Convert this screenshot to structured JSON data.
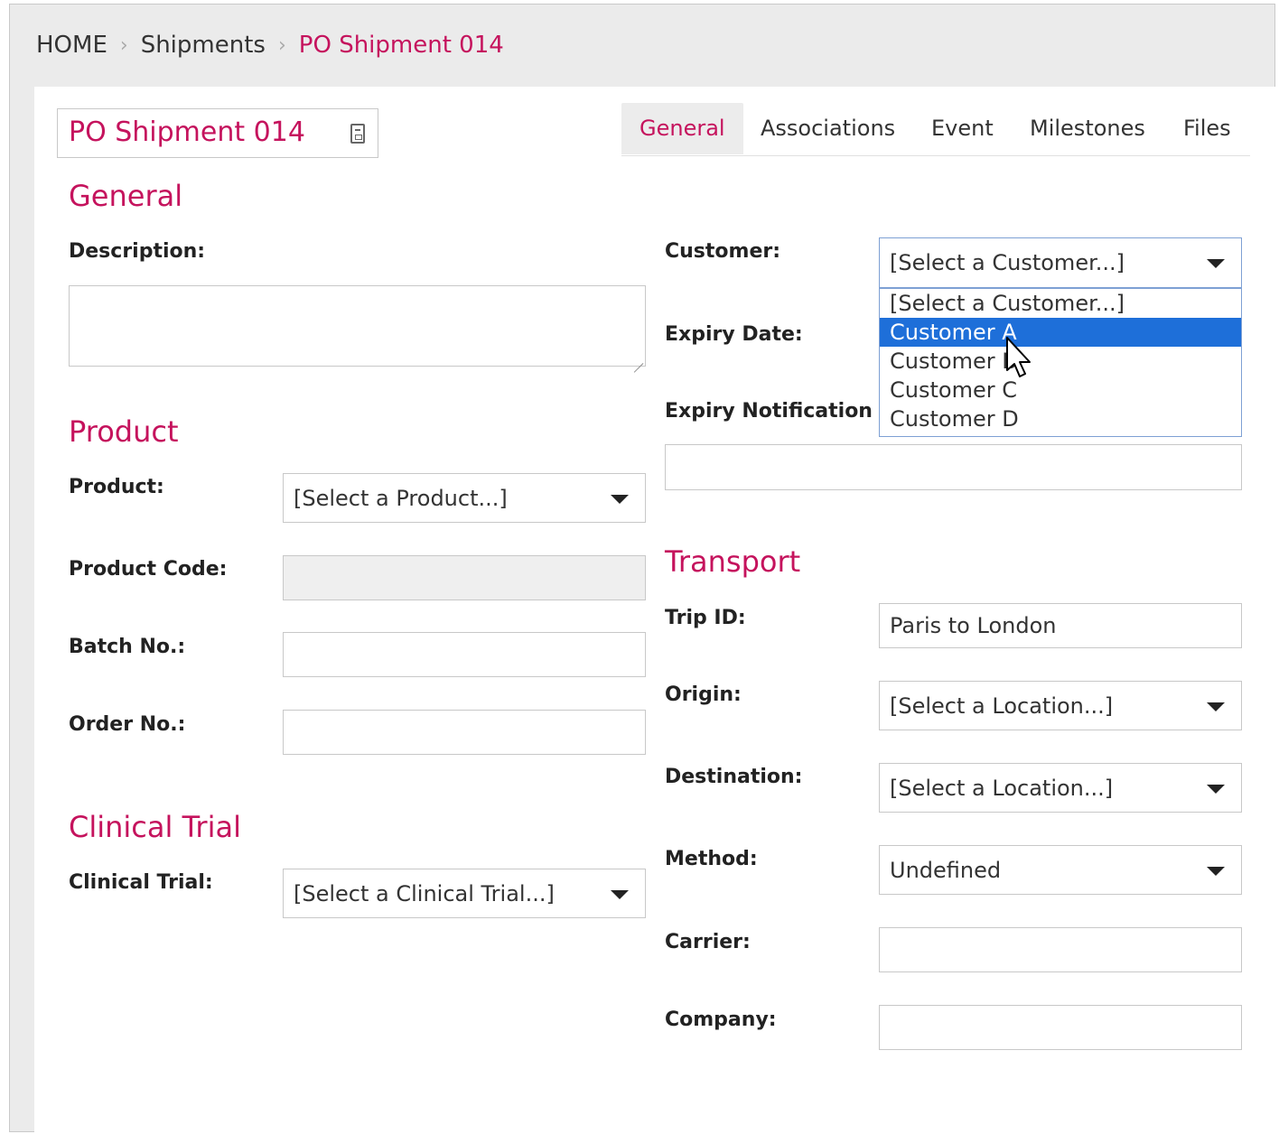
{
  "breadcrumb": {
    "home": "HOME",
    "section": "Shipments",
    "current": "PO Shipment 014"
  },
  "record_title": "PO Shipment 014",
  "tabs": [
    {
      "label": "General",
      "active": true
    },
    {
      "label": "Associations"
    },
    {
      "label": "Event"
    },
    {
      "label": "Milestones"
    },
    {
      "label": "Files"
    }
  ],
  "general": {
    "heading": "General",
    "description_label": "Description:",
    "description_value": "",
    "customer_label": "Customer:",
    "customer_value": "[Select a Customer...]",
    "customer_options": [
      "[Select a Customer...]",
      "Customer A",
      "Customer B",
      "Customer C",
      "Customer D"
    ],
    "customer_highlighted": "Customer A",
    "expiry_date_label": "Expiry Date:",
    "expiry_notification_label": "Expiry Notification Re",
    "expiry_notification_value": ""
  },
  "product": {
    "heading": "Product",
    "product_label": "Product:",
    "product_value": "[Select a Product...]",
    "product_code_label": "Product Code:",
    "product_code_value": "",
    "batch_label": "Batch No.:",
    "batch_value": "",
    "order_label": "Order No.:",
    "order_value": ""
  },
  "clinical": {
    "heading": "Clinical Trial",
    "clinical_label": "Clinical Trial:",
    "clinical_value": "[Select a Clinical Trial...]"
  },
  "transport": {
    "heading": "Transport",
    "trip_label": "Trip ID:",
    "trip_value": "Paris to London",
    "origin_label": "Origin:",
    "origin_value": "[Select a Location...]",
    "destination_label": "Destination:",
    "destination_value": "[Select a Location...]",
    "method_label": "Method:",
    "method_value": "Undefined",
    "carrier_label": "Carrier:",
    "carrier_value": "",
    "company_label": "Company:",
    "company_value": ""
  },
  "colors": {
    "accent": "#c5135d",
    "highlight": "#1e6fd9"
  }
}
